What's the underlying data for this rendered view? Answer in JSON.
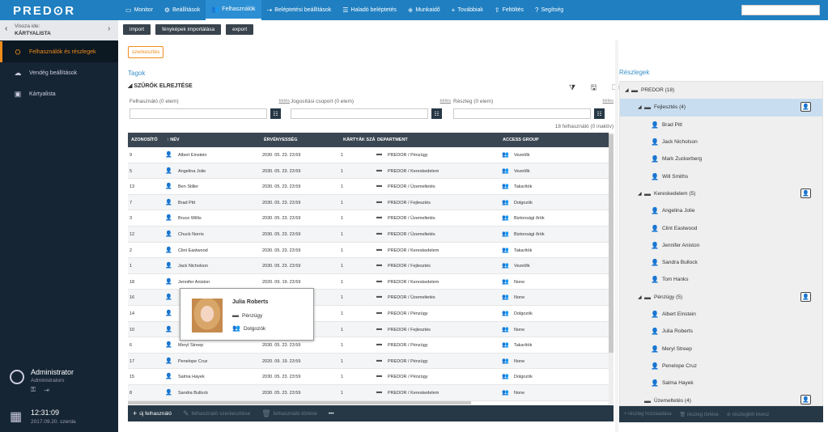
{
  "app": {
    "logo": "PRED⊙R"
  },
  "nav": [
    {
      "icon": "▭",
      "label": "Monitor"
    },
    {
      "icon": "⚙",
      "label": "Beállítások"
    },
    {
      "icon": "👥",
      "label": "Felhasználók",
      "active": true
    },
    {
      "icon": "⇢",
      "label": "Beléptetési beállítások"
    },
    {
      "icon": "☰",
      "label": "Haladó beléptetés"
    },
    {
      "icon": "⎈",
      "label": "Munkaidő"
    },
    {
      "icon": "+",
      "label": "Továbbiak"
    },
    {
      "icon": "⇧",
      "label": "Feltöltés"
    },
    {
      "icon": "?",
      "label": "Segítség"
    }
  ],
  "sidebar": {
    "back_to": "Vissza ide:",
    "back_title": "KÁRTYALISTA",
    "items": [
      {
        "icon": "⛭",
        "label": "Felhasználók és részlegek",
        "active": true
      },
      {
        "icon": "☁",
        "label": "Vendég beállítások"
      },
      {
        "icon": "▣",
        "label": "Kártyalista"
      }
    ],
    "user_name": "Administrator",
    "user_role": "Administrators",
    "user_actions": "⚿ ⇥",
    "clock_time": "12:31:09",
    "clock_date": "2017.09.20. szerda"
  },
  "toolbar": {
    "import": "import",
    "photo_import": "fényképek importálása",
    "export": "export",
    "edit": "szerkesztés"
  },
  "tags_label": "Tagok",
  "filters": {
    "title": "SZŰRŐK ELREJTÉSE",
    "icons": "⧩ 🖫 🗀",
    "items": [
      {
        "label": "Felhasználó",
        "count": "(0 elem)",
        "clear": "törlés"
      },
      {
        "label": "Jogosítási csoport",
        "count": "(0 elem)",
        "clear": "törlés"
      },
      {
        "label": "Részleg",
        "count": "(0 elem)",
        "clear": "törlés"
      }
    ]
  },
  "result_count": "18 felhasználó (0 inaktív)",
  "table": {
    "headers": {
      "id": "AZONOSÍTÓ",
      "name": "↑ NÉV",
      "valid": "ÉRVÉNYESSÉG",
      "cards": "KÁRTYÁK SZÁ",
      "dept": "DEPARTMENT",
      "group": "ACCESS GROUP"
    },
    "rows": [
      {
        "id": "9",
        "name": "Albert Einstein",
        "valid": "2030. 05. 23. 23:59",
        "cards": "1",
        "dept": "PREDOR / Pénzügy",
        "group": "Vezetők"
      },
      {
        "id": "5",
        "name": "Angelina  Jolie",
        "valid": "2030. 05. 23. 23:59",
        "cards": "1",
        "dept": "PREDOR / Kereskedelem",
        "group": "Vezetők"
      },
      {
        "id": "13",
        "name": "Ben Stiller",
        "valid": "2030. 05. 23. 23:59",
        "cards": "1",
        "dept": "PREDOR / Üzemeltetés",
        "group": "Takarítók"
      },
      {
        "id": "7",
        "name": "Brad Pitt",
        "valid": "2030. 05. 23. 23:59",
        "cards": "1",
        "dept": "PREDOR / Fejlesztés",
        "group": "Dolgozók"
      },
      {
        "id": "3",
        "name": "Bruce Willis",
        "valid": "2030. 05. 23. 23:59",
        "cards": "1",
        "dept": "PREDOR / Üzemeltetés",
        "group": "Biztonsági őrök"
      },
      {
        "id": "12",
        "name": "Chuck Norris",
        "valid": "2030. 05. 23. 23:59",
        "cards": "1",
        "dept": "PREDOR / Üzemeltetés",
        "group": "Biztonsági őrök"
      },
      {
        "id": "2",
        "name": "Clint Eastwood",
        "valid": "2030. 05. 23. 23:59",
        "cards": "1",
        "dept": "PREDOR / Kereskedelem",
        "group": "Takarítók"
      },
      {
        "id": "1",
        "name": "Jack  Nicholson",
        "valid": "2030. 05. 23. 23:59",
        "cards": "1",
        "dept": "PREDOR / Fejlesztés",
        "group": "Vezetők"
      },
      {
        "id": "18",
        "name": "Jennifer Aniston",
        "valid": "2020. 09. 19. 23:59",
        "cards": "1",
        "dept": "PREDOR / Kereskedelem",
        "group": "None"
      },
      {
        "id": "16",
        "name": "",
        "valid": "",
        "cards": "1",
        "dept": "PREDOR / Üzemeltetés",
        "group": "None"
      },
      {
        "id": "14",
        "name": "",
        "valid": "",
        "cards": "1",
        "dept": "PREDOR / Pénzügy",
        "group": "Dolgozók",
        "highlight": true
      },
      {
        "id": "10",
        "name": "",
        "valid": "",
        "cards": "1",
        "dept": "PREDOR / Fejlesztés",
        "group": "None"
      },
      {
        "id": "6",
        "name": "Meryl Streep",
        "valid": "2030. 05. 23. 23:59",
        "cards": "1",
        "dept": "PREDOR / Pénzügy",
        "group": "Takarítók"
      },
      {
        "id": "17",
        "name": "Penelope Cruz",
        "valid": "2020. 09. 19. 23:59",
        "cards": "1",
        "dept": "PREDOR / Pénzügy",
        "group": "None"
      },
      {
        "id": "15",
        "name": "Salma Hayek",
        "valid": "2030. 05. 23. 23:59",
        "cards": "1",
        "dept": "PREDOR / Pénzügy",
        "group": "Dolgozók"
      },
      {
        "id": "8",
        "name": "Sandra Bullock",
        "valid": "2030. 05. 23. 23:59",
        "cards": "1",
        "dept": "PREDOR / Kereskedelem",
        "group": "None"
      }
    ],
    "footer": {
      "new_user": "új felhasználó",
      "edit_user": "felhasználó szerkesztése",
      "delete_user": "felhasználó törlése",
      "more": "•••"
    }
  },
  "popup": {
    "name": "Julia Roberts",
    "dept": "Pénzügy",
    "group": "Dolgozók"
  },
  "departments": {
    "label": "Részlegek",
    "nodes": [
      {
        "level": 0,
        "type": "dept",
        "label": "PREDOR (18)",
        "caret": "◢"
      },
      {
        "level": 1,
        "type": "dept",
        "label": "Fejlesztés (4)",
        "caret": "◢",
        "selected": true,
        "card": true
      },
      {
        "level": 2,
        "type": "user",
        "label": "Brad Pitt"
      },
      {
        "level": 2,
        "type": "user",
        "label": "Jack  Nicholson"
      },
      {
        "level": 2,
        "type": "user",
        "label": "Mark Zuckerberg"
      },
      {
        "level": 2,
        "type": "user",
        "label": "Will Smiths"
      },
      {
        "level": 1,
        "type": "dept",
        "label": "Kereskedelem (5)",
        "caret": "◢",
        "card": true
      },
      {
        "level": 2,
        "type": "user",
        "label": "Angelina  Jolie"
      },
      {
        "level": 2,
        "type": "user",
        "label": "Clint Eastwood"
      },
      {
        "level": 2,
        "type": "user",
        "label": "Jennifer Aniston"
      },
      {
        "level": 2,
        "type": "user",
        "label": "Sandra Bullock"
      },
      {
        "level": 2,
        "type": "user",
        "label": "Tom Hanks"
      },
      {
        "level": 1,
        "type": "dept",
        "label": "Pénzügy (5)",
        "caret": "◢",
        "card": true
      },
      {
        "level": 2,
        "type": "user",
        "label": "Albert Einstein"
      },
      {
        "level": 2,
        "type": "user",
        "label": "Julia Roberts"
      },
      {
        "level": 2,
        "type": "user",
        "label": "Meryl Streep"
      },
      {
        "level": 2,
        "type": "user",
        "label": "Penelope Cruz"
      },
      {
        "level": 2,
        "type": "user",
        "label": "Salma Hayek"
      },
      {
        "level": 1,
        "type": "dept",
        "label": "Üzemeltetés (4)",
        "caret": "",
        "card": true
      }
    ],
    "footer": {
      "add": "részleg hozzáadása",
      "delete": "részleg törlése",
      "remove_user": "részlegből kivesz"
    }
  }
}
